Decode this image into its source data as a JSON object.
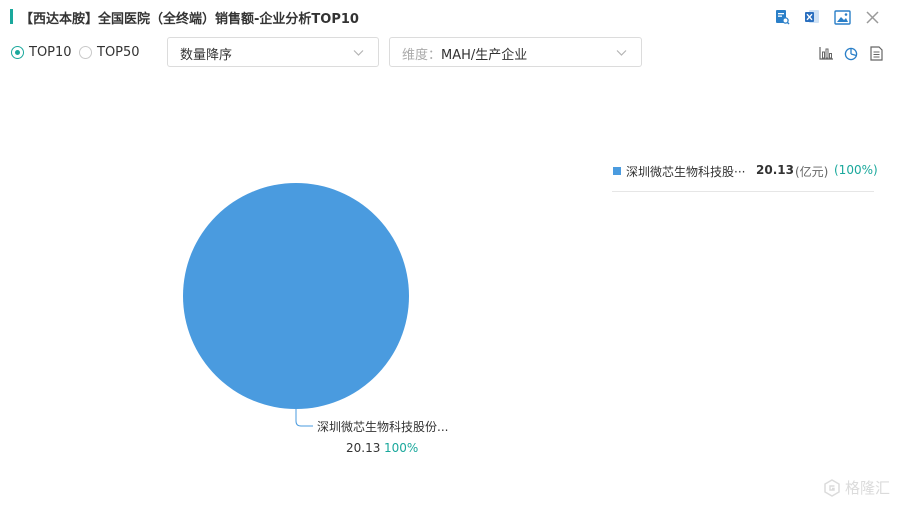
{
  "header": {
    "title": "【西达本胺】全国医院（全终端）销售额-企业分析TOP10",
    "accent_color": "#1aa89c",
    "tools": [
      "search-report-icon",
      "export-excel-icon",
      "export-image-icon",
      "close-icon"
    ]
  },
  "controls": {
    "radios": [
      {
        "label": "TOP10",
        "selected": true
      },
      {
        "label": "TOP50",
        "selected": false
      }
    ],
    "sort_select": {
      "value": "数量降序"
    },
    "dimension_select": {
      "prefix": "维度：",
      "value": "MAH/生产企业"
    },
    "view_tools": [
      "bar-chart-icon",
      "pie-chart-icon",
      "table-icon"
    ]
  },
  "chart_data": {
    "type": "pie",
    "unit": "(亿元)",
    "slices": [
      {
        "name": "深圳微芯生物科技股份...",
        "legend_name": "深圳微芯生物科技股···",
        "value": 20.13,
        "value_label": "20.13",
        "percent": "100%",
        "legend_percent": "(100%)",
        "color": "#4a9bdf"
      }
    ],
    "legend_position": "right"
  },
  "watermark": {
    "text": "格隆汇",
    "icon": "glh-logo-icon"
  }
}
